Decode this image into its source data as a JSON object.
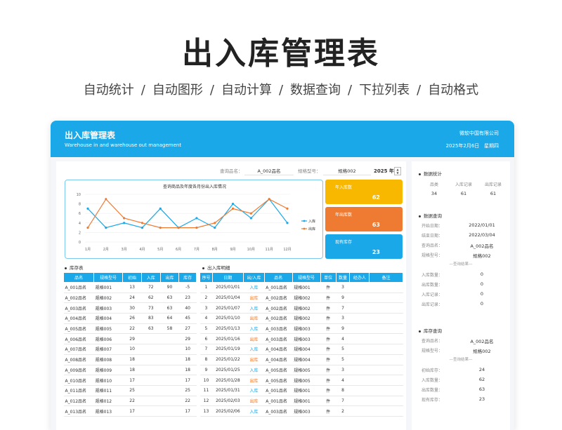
{
  "hero": {
    "title": "出入库管理表",
    "features": [
      "自动统计",
      "/",
      "自动图形",
      "/",
      "自动计算",
      "/",
      "数据查询",
      "/",
      "下拉列表",
      "/",
      "自动格式"
    ]
  },
  "header": {
    "title": "出入库管理表",
    "subtitle": "Warehouse in and warehouse out management",
    "company": "微软中国有限公司",
    "date": "2025年2月6日",
    "weekday": "星期四"
  },
  "filters": {
    "name_label": "查询品名：",
    "name_value": "A_002品名",
    "model_label": "规格型号：",
    "model_value": "规格002",
    "year_value": "2025",
    "year_unit": "年",
    "spin_up": "▲",
    "spin_down": "▼"
  },
  "kpis": [
    {
      "label": "年入库数",
      "value": "62",
      "color": "#f9b800"
    },
    {
      "label": "年出库数",
      "value": "63",
      "color": "#ef7a31"
    },
    {
      "label": "现有库存",
      "value": "23",
      "color": "#1aa8e8"
    }
  ],
  "chart_data": {
    "type": "line",
    "title": "查询商品及年度各月份出入库情况",
    "categories": [
      "1月",
      "2月",
      "3月",
      "4月",
      "5月",
      "6月",
      "7月",
      "8月",
      "9月",
      "10月",
      "11月",
      "12月"
    ],
    "ylim": [
      0,
      10
    ],
    "yticks": [
      "0",
      "2",
      "4",
      "6",
      "8",
      "10"
    ],
    "series": [
      {
        "name": "入库",
        "color": "#1aa8e8",
        "values": [
          7,
          3,
          4,
          3,
          7,
          3,
          5,
          3,
          8,
          5,
          9,
          4
        ]
      },
      {
        "name": "出库",
        "color": "#ef7a31",
        "values": [
          3,
          9,
          5,
          4,
          3,
          3,
          3,
          4,
          7,
          6,
          9,
          7
        ]
      }
    ],
    "legend": "right"
  },
  "inventory": {
    "title": "库存表",
    "columns": [
      "品名",
      "规格型号",
      "初始",
      "入库",
      "出库",
      "库存"
    ],
    "rows": [
      [
        "A_001品名",
        "规格001",
        "13",
        "72",
        "90",
        "-5"
      ],
      [
        "A_002品名",
        "规格002",
        "24",
        "62",
        "63",
        "23"
      ],
      [
        "A_003品名",
        "规格003",
        "30",
        "73",
        "63",
        "40"
      ],
      [
        "A_004品名",
        "规格004",
        "26",
        "83",
        "64",
        "45"
      ],
      [
        "A_005品名",
        "规格005",
        "22",
        "63",
        "58",
        "27"
      ],
      [
        "A_006品名",
        "规格006",
        "29",
        "",
        "",
        "29"
      ],
      [
        "A_007品名",
        "规格007",
        "10",
        "",
        "",
        "10"
      ],
      [
        "A_008品名",
        "规格008",
        "18",
        "",
        "",
        "18"
      ],
      [
        "A_009品名",
        "规格009",
        "18",
        "",
        "",
        "18"
      ],
      [
        "A_010品名",
        "规格010",
        "17",
        "",
        "",
        "17"
      ],
      [
        "A_011品名",
        "规格011",
        "25",
        "",
        "",
        "25"
      ],
      [
        "A_012品名",
        "规格012",
        "22",
        "",
        "",
        "22"
      ],
      [
        "A_013品名",
        "规格013",
        "17",
        "",
        "",
        "17"
      ]
    ]
  },
  "detail": {
    "title": "出入库明细",
    "columns": [
      "序号",
      "日期",
      "出/入库",
      "品名",
      "规格型号",
      "单位",
      "数量",
      "经办人",
      "备注"
    ],
    "in_color": "#1aa8e8",
    "out_color": "#ef7a31",
    "rows": [
      [
        "1",
        "2025/01/01",
        "入库",
        "A_001品名",
        "规格001",
        "件",
        "3",
        "",
        ""
      ],
      [
        "2",
        "2025/01/04",
        "出库",
        "A_002品名",
        "规格002",
        "件",
        "9",
        "",
        ""
      ],
      [
        "3",
        "2025/01/07",
        "入库",
        "A_002品名",
        "规格002",
        "件",
        "7",
        "",
        ""
      ],
      [
        "4",
        "2025/01/10",
        "出库",
        "A_002品名",
        "规格002",
        "件",
        "3",
        "",
        ""
      ],
      [
        "5",
        "2025/01/13",
        "入库",
        "A_003品名",
        "规格003",
        "件",
        "9",
        "",
        ""
      ],
      [
        "6",
        "2025/01/16",
        "出库",
        "A_003品名",
        "规格003",
        "件",
        "4",
        "",
        ""
      ],
      [
        "7",
        "2025/01/19",
        "入库",
        "A_004品名",
        "规格004",
        "件",
        "5",
        "",
        ""
      ],
      [
        "8",
        "2025/01/22",
        "出库",
        "A_004品名",
        "规格004",
        "件",
        "5",
        "",
        ""
      ],
      [
        "9",
        "2025/01/25",
        "入库",
        "A_005品名",
        "规格005",
        "件",
        "3",
        "",
        ""
      ],
      [
        "10",
        "2025/01/28",
        "出库",
        "A_005品名",
        "规格005",
        "件",
        "4",
        "",
        ""
      ],
      [
        "11",
        "2025/01/31",
        "入库",
        "A_001品名",
        "规格001",
        "件",
        "8",
        "",
        ""
      ],
      [
        "12",
        "2025/02/03",
        "出库",
        "A_001品名",
        "规格001",
        "件",
        "7",
        "",
        ""
      ],
      [
        "13",
        "2025/02/06",
        "入库",
        "A_003品名",
        "规格003",
        "件",
        "2",
        "",
        ""
      ]
    ]
  },
  "side": {
    "stats": {
      "title": "数据统计",
      "headers": [
        "品类",
        "入库记录",
        "出库记录"
      ],
      "values": [
        "34",
        "61",
        "61"
      ]
    },
    "query": {
      "title": "数据查询",
      "rows": [
        {
          "label": "开始日期：",
          "value": "2022/01/01"
        },
        {
          "label": "结束日期：",
          "value": "2022/03/04"
        },
        {
          "label": "查询品名：",
          "value": "A_002品名"
        },
        {
          "label": "规格型号：",
          "value": "规格002"
        }
      ],
      "result_sep": "—查询结果—",
      "results": [
        {
          "label": "入库数量：",
          "value": "0"
        },
        {
          "label": "出库数量：",
          "value": "0"
        },
        {
          "label": "入库记录：",
          "value": "0"
        },
        {
          "label": "出库记录：",
          "value": "0"
        }
      ]
    },
    "stock": {
      "title": "库存查询",
      "rows": [
        {
          "label": "查询品名：",
          "value": "A_002品名"
        },
        {
          "label": "规格型号：",
          "value": "规格002"
        }
      ],
      "result_sep": "—查询结果—",
      "results": [
        {
          "label": "初始库存：",
          "value": "24"
        },
        {
          "label": "入库数量：",
          "value": "62"
        },
        {
          "label": "出库数量：",
          "value": "63"
        },
        {
          "label": "现有库存：",
          "value": "23"
        }
      ]
    }
  }
}
